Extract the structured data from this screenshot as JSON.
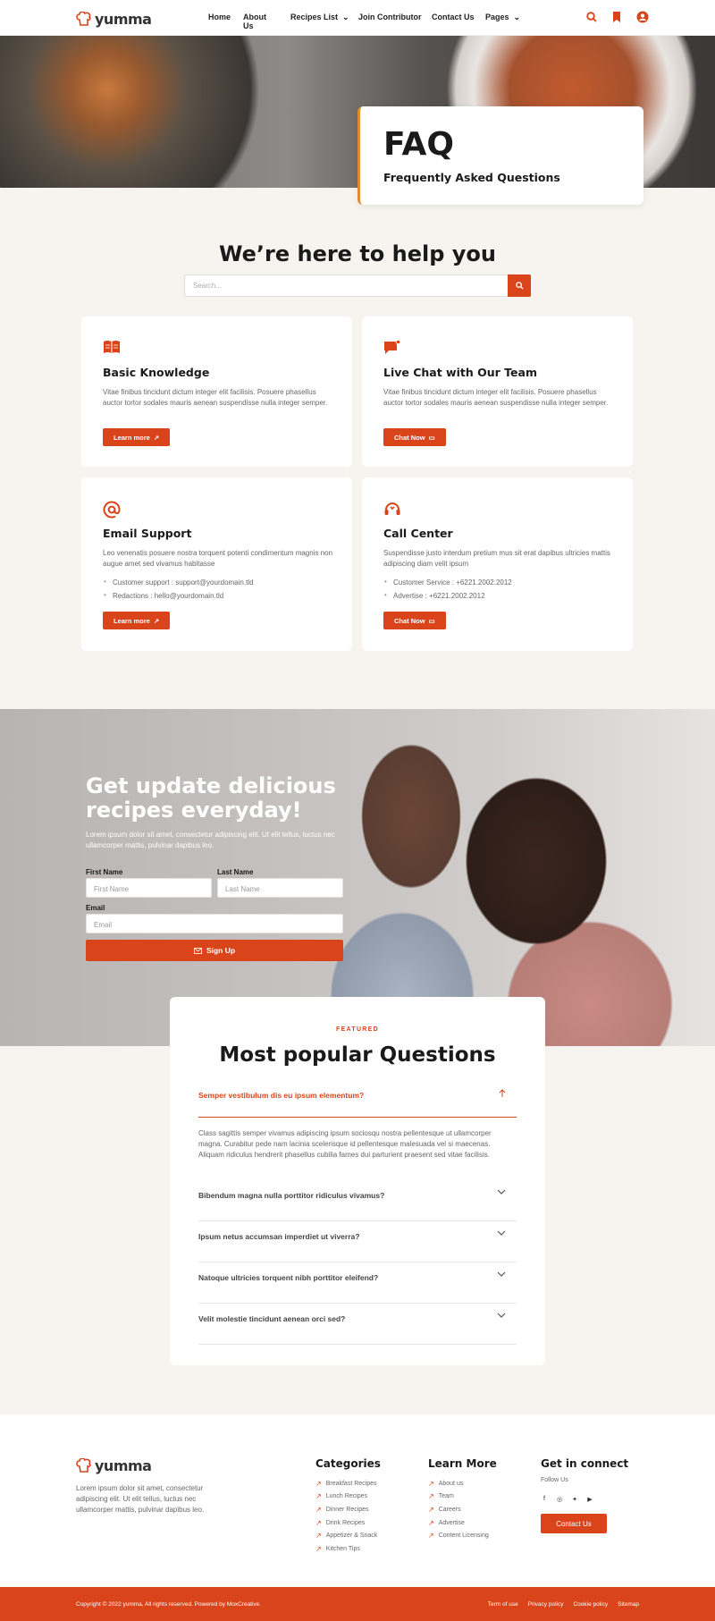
{
  "brand": {
    "name": "yumma",
    "accent": "#d9441a"
  },
  "nav": {
    "items": [
      "Home",
      "About Us",
      "Recipes List",
      "Join Contributor",
      "Contact Us",
      "Pages"
    ]
  },
  "hero": {
    "title": "FAQ",
    "subtitle": "Frequently Asked Questions"
  },
  "help": {
    "heading": "We’re here to help you",
    "search_placeholder": "Search..."
  },
  "cards": [
    {
      "title": "Basic Knowledge",
      "text": "Vitae finibus tincidunt dictum integer elit facilisis. Posuere phasellus auctor tortor sodales mauris aenean suspendisse nulla integer semper.",
      "button": "Learn more",
      "icon": "book-icon"
    },
    {
      "title": "Live Chat with Our Team",
      "text": "Vitae finibus tincidunt dictum integer elit facilisis. Posuere phasellus auctor tortor sodales mauris aenean suspendisse nulla integer semper.",
      "button": "Chat Now",
      "icon": "chat-icon"
    },
    {
      "title": "Email Support",
      "text": "Leo venenatis posuere nostra torquent potenti condimentum magnis non augue amet sed vivamus habitasse",
      "bullets": [
        "Customer support : support@yourdomain.tld",
        "Redactions : hello@yourdomain.tld"
      ],
      "button": "Learn more",
      "icon": "at-icon"
    },
    {
      "title": "Call Center",
      "text": "Suspendisse justo interdum pretium mus sit erat dapibus ultricies mattis adipiscing diam velit ipsum",
      "bullets": [
        "Customer Service : +6221.2002.2012",
        "Advertise : +6221.2002.2012"
      ],
      "button": "Chat Now",
      "icon": "headset-icon"
    }
  ],
  "newsletter": {
    "title": "Get update delicious recipes everyday!",
    "lead": "Lorem ipsum dolor sit amet, consectetur adipiscing elit. Ut elit tellus, luctus nec ullamcorper mattis, pulvinar dapibus leo.",
    "first_label": "First Name",
    "first_placeholder": "First Name",
    "last_label": "Last Name",
    "last_placeholder": "Last Name",
    "email_label": "Email",
    "email_placeholder": "Email",
    "button": "Sign Up"
  },
  "popular": {
    "eyebrow": "FEATURED",
    "title": "Most popular Questions",
    "questions": [
      {
        "q": "Semper vestibulum dis eu ipsum elementum?",
        "a": "Class sagittis semper vivamus adipiscing ipsum sociosqu nostra pellentesque ut ullamcorper magna. Curabitur pede nam lacinia scelerisque id pellentesque malesuada vel si maecenas. Aliquam ridiculus hendrerit phasellus cubilia fames dui parturient praesent sed vitae facilisis."
      },
      {
        "q": "Bibendum magna nulla porttitor ridiculus vivamus?"
      },
      {
        "q": "Ipsum netus accumsan imperdiet ut viverra?"
      },
      {
        "q": "Natoque ultricies torquent nibh porttitor eleifend?"
      },
      {
        "q": "Velit molestie tincidunt aenean orci sed?"
      }
    ]
  },
  "footer": {
    "desc": "Lorem ipsum dolor sit amet, consectetur adipiscing elit. Ut elit tellus, luctus nec ullamcorper mattis, pulvinar dapibus leo.",
    "categories_title": "Categories",
    "categories": [
      "Breakfast Recipes",
      "Lunch Recipes",
      "Dinner Recipes",
      "Drink Recipes",
      "Appetizer & Snack",
      "Kitchen Tips"
    ],
    "learn_title": "Learn More",
    "learn": [
      "About us",
      "Team",
      "Careers",
      "Advertise",
      "Content Licensing"
    ],
    "connect_title": "Get in connect",
    "follow": "Follow Us",
    "contact_button": "Contact Us",
    "copyright": "Copyright © 2022 yumma, All rights reserved. Powered by MoxCreative.",
    "links": [
      "Term of use",
      "Privacy policy",
      "Cookie policy",
      "Sitemap"
    ]
  }
}
